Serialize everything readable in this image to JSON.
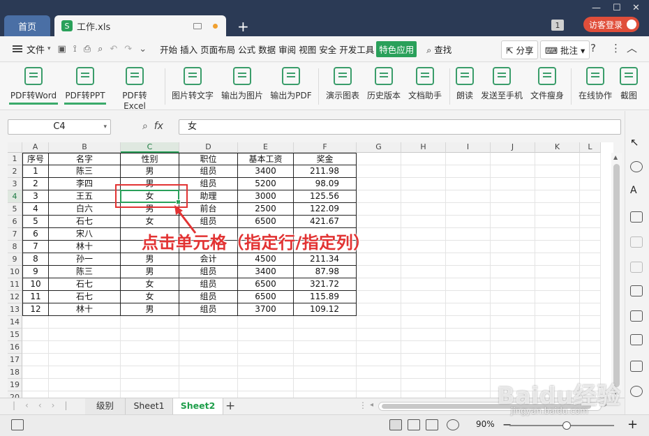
{
  "titlebar": {
    "home_tab": "首页",
    "file_tab": "工作.xls",
    "file_icon": "S",
    "window_count": "1",
    "guest_login": "访客登录"
  },
  "menubar": {
    "file_menu": "文件",
    "tabs": [
      "开始",
      "插入",
      "页面布局",
      "公式",
      "数据",
      "审阅",
      "视图",
      "安全",
      "开发工具",
      "特色应用"
    ],
    "active_tab": "特色应用",
    "search": "查找",
    "share": "分享",
    "comment": "批注"
  },
  "toolbar": {
    "tools": [
      "PDF转Word",
      "PDF转PPT",
      "PDF转Excel",
      "图片转文字",
      "输出为图片",
      "输出为PDF",
      "演示图表",
      "历史版本",
      "文档助手",
      "朗读",
      "发送至手机",
      "文件瘦身",
      "在线协作",
      "截图"
    ]
  },
  "formula_bar": {
    "name_box": "C4",
    "fx_label": "fx",
    "formula": "女"
  },
  "sheet": {
    "columns": [
      "A",
      "B",
      "C",
      "D",
      "E",
      "F",
      "G",
      "H",
      "I",
      "J",
      "K",
      "L"
    ],
    "row_numbers": [
      "1",
      "2",
      "3",
      "4",
      "5",
      "6",
      "7",
      "8",
      "9",
      "10",
      "11",
      "12",
      "13",
      "14",
      "15",
      "16",
      "17",
      "18",
      "19",
      "20"
    ],
    "header_row": [
      "序号",
      "名字",
      "性别",
      "职位",
      "基本工资",
      "奖金"
    ],
    "rows": [
      [
        "1",
        "陈三",
        "男",
        "组员",
        "3400",
        "211.98"
      ],
      [
        "2",
        "李四",
        "男",
        "组员",
        "5200",
        "98.09"
      ],
      [
        "3",
        "王五",
        "女",
        "助理",
        "3000",
        "125.56"
      ],
      [
        "4",
        "白六",
        "男",
        "前台",
        "2500",
        "122.09"
      ],
      [
        "5",
        "石七",
        "女",
        "组员",
        "6500",
        "421.67"
      ],
      [
        "6",
        "宋八",
        "",
        "",
        "",
        ""
      ],
      [
        "7",
        "林十",
        "",
        "",
        "",
        ""
      ],
      [
        "8",
        "孙一",
        "男",
        "会计",
        "4500",
        "211.34"
      ],
      [
        "9",
        "陈三",
        "男",
        "组员",
        "3400",
        "87.98"
      ],
      [
        "10",
        "石七",
        "女",
        "组员",
        "6500",
        "321.72"
      ],
      [
        "11",
        "石七",
        "女",
        "组员",
        "6500",
        "115.89"
      ],
      [
        "12",
        "林十",
        "男",
        "组员",
        "3700",
        "109.12"
      ]
    ]
  },
  "annotation": {
    "text": "点击单元格（指定行/指定列）"
  },
  "sheet_tabs": [
    "级别",
    "Sheet1",
    "Sheet2"
  ],
  "active_sheet": "Sheet2",
  "status": {
    "zoom": "90%"
  },
  "watermark": {
    "brand": "Baidu经验",
    "url": "jingyan.baidu.com"
  },
  "colors": {
    "accent": "#2aa05a",
    "annotation": "#e23333",
    "titlebar": "#2b3a55"
  }
}
